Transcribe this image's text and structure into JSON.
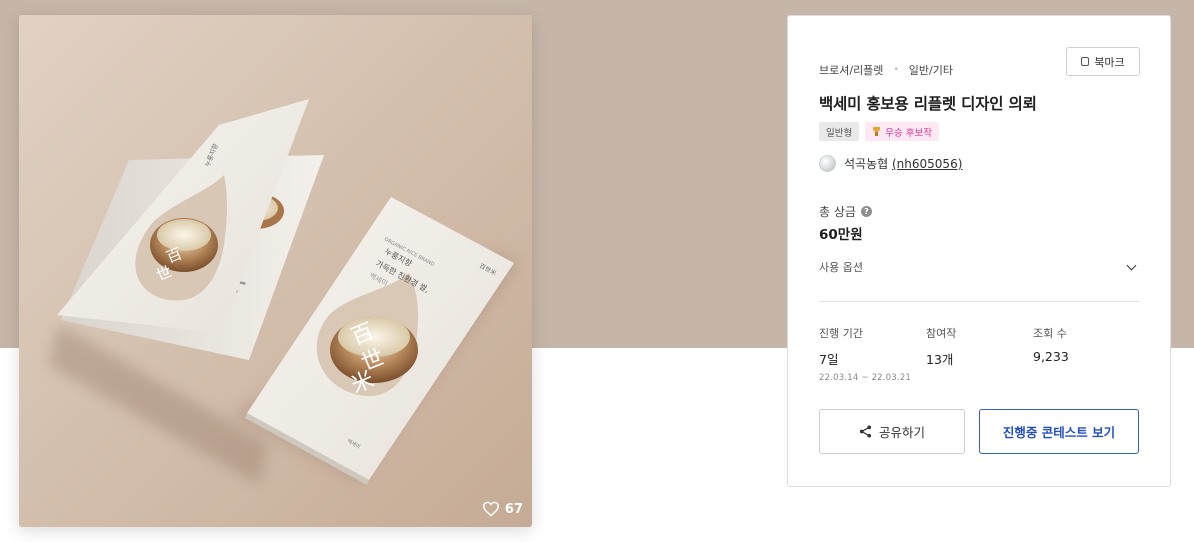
{
  "image": {
    "like_count": "67",
    "mockup": {
      "brand_small": "ORGANIC RICE BRAND",
      "headline_line1": "누룽지향",
      "headline_line2": "가득한 친환경 쌀,",
      "headline_line3": "백세미",
      "logo_text": "百世米",
      "char_one": "百",
      "char_two": "世",
      "char_three": "米",
      "corner_label": "백세미"
    }
  },
  "breadcrumb": {
    "category": "브로셔/리플렛",
    "subcategory": "일반/기타"
  },
  "bookmark": {
    "label": "북마크"
  },
  "title": "백세미 홍보용 리플렛 디자인 의뢰",
  "tags": {
    "type": "일반형",
    "award": "우승 후보작"
  },
  "author": {
    "name": "석곡농협",
    "id": "(nh605056)"
  },
  "prize": {
    "label": "총 상금",
    "help": "?",
    "value": "60만원"
  },
  "usage": {
    "label": "사용 옵션"
  },
  "stats": {
    "period_label": "진행 기간",
    "period_value": "7일",
    "period_range": "22.03.14 ~ 22.03.21",
    "entries_label": "참여작",
    "entries_value": "13개",
    "views_label": "조회 수",
    "views_value": "9,233"
  },
  "actions": {
    "share_label": "공유하기",
    "contest_label": "진행중 콘테스트 보기"
  },
  "colors": {
    "band": "#c6b6a9",
    "accent_blue": "#2350c0",
    "award_pink": "#e0348d"
  }
}
